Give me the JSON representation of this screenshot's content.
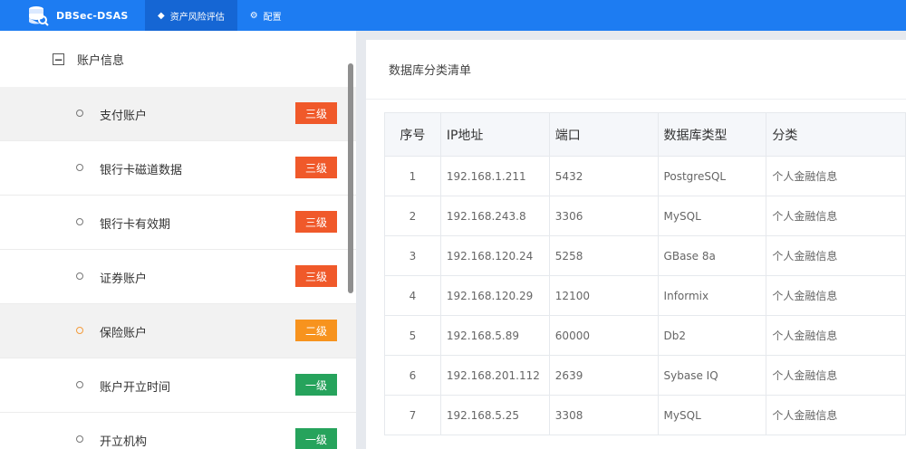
{
  "app": {
    "title": "DBSec-DSAS",
    "nav": [
      {
        "label": "资产风险评估",
        "active": true
      },
      {
        "label": "配置",
        "active": false
      }
    ]
  },
  "sidebar": {
    "root_label": "账户信息",
    "items": [
      {
        "label": "支付账户",
        "badge": "三级",
        "badge_color": "#f0592a",
        "highlight": true,
        "dot": "gray"
      },
      {
        "label": "银行卡磁道数据",
        "badge": "三级",
        "badge_color": "#f0592a",
        "highlight": false,
        "dot": "gray"
      },
      {
        "label": "银行卡有效期",
        "badge": "三级",
        "badge_color": "#f0592a",
        "highlight": false,
        "dot": "gray"
      },
      {
        "label": "证券账户",
        "badge": "三级",
        "badge_color": "#f0592a",
        "highlight": false,
        "dot": "gray"
      },
      {
        "label": "保险账户",
        "badge": "二级",
        "badge_color": "#f7931e",
        "highlight": true,
        "dot": "orange"
      },
      {
        "label": "账户开立时间",
        "badge": "一级",
        "badge_color": "#26a35c",
        "highlight": false,
        "dot": "gray"
      },
      {
        "label": "开立机构",
        "badge": "一级",
        "badge_color": "#26a35c",
        "highlight": false,
        "dot": "gray"
      }
    ]
  },
  "main": {
    "title": "数据库分类清单",
    "table": {
      "headers": [
        "序号",
        "IP地址",
        "端口",
        "数据库类型",
        "分类"
      ],
      "rows": [
        [
          "1",
          "192.168.1.211",
          "5432",
          "PostgreSQL",
          "个人金融信息"
        ],
        [
          "2",
          "192.168.243.8",
          "3306",
          "MySQL",
          "个人金融信息"
        ],
        [
          "3",
          "192.168.120.24",
          "5258",
          "GBase 8a",
          "个人金融信息"
        ],
        [
          "4",
          "192.168.120.29",
          "12100",
          "Informix",
          "个人金融信息"
        ],
        [
          "5",
          "192.168.5.89",
          "60000",
          "Db2",
          "个人金融信息"
        ],
        [
          "6",
          "192.168.201.112",
          "2639",
          "Sybase IQ",
          "个人金融信息"
        ],
        [
          "7",
          "192.168.5.25",
          "3308",
          "MySQL",
          "个人金融信息"
        ]
      ]
    }
  }
}
